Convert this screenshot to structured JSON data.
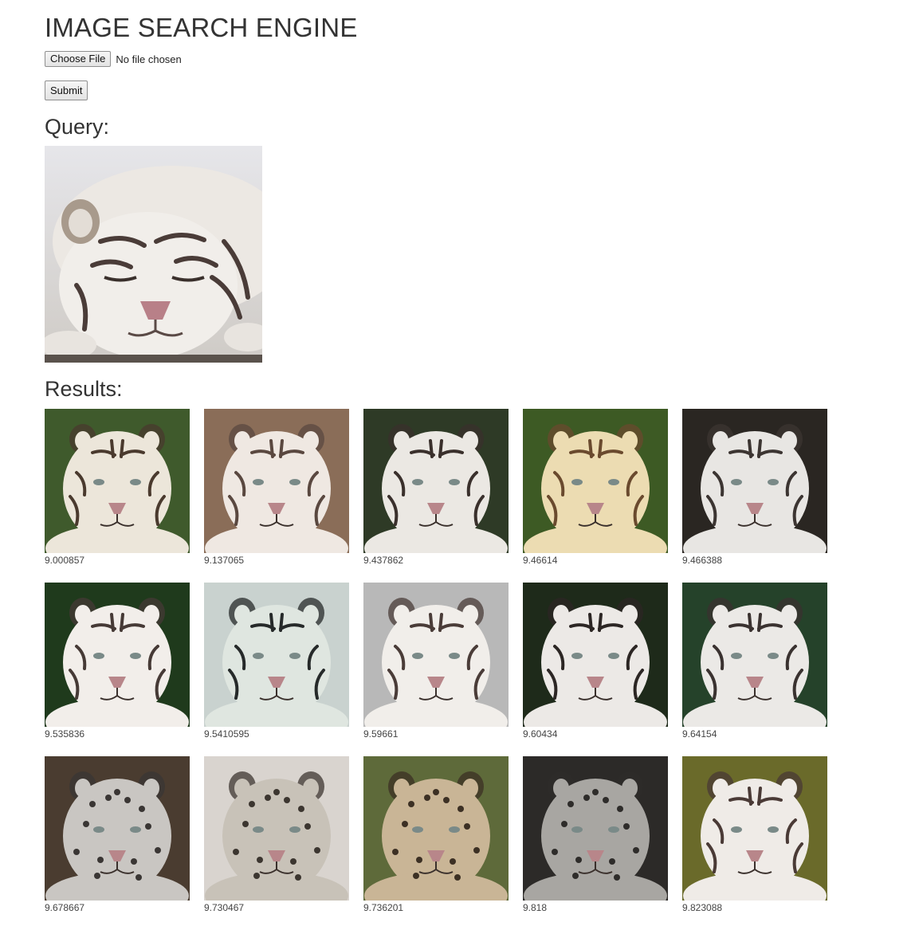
{
  "header": {
    "title": "IMAGE SEARCH ENGINE"
  },
  "form": {
    "choose_file_label": "Choose File",
    "file_status": "No file chosen",
    "submit_label": "Submit"
  },
  "query": {
    "heading": "Query:"
  },
  "results": {
    "heading": "Results:",
    "items": [
      {
        "score": "9.000857",
        "bg": "#3f5a2c",
        "fur": "#ece6da",
        "stripe": "#4a3a2e"
      },
      {
        "score": "9.137065",
        "bg": "#8a6d58",
        "fur": "#efe8e2",
        "stripe": "#5a4840"
      },
      {
        "score": "9.437862",
        "bg": "#2e3a26",
        "fur": "#ebe8e3",
        "stripe": "#3a302c"
      },
      {
        "score": "9.46614",
        "bg": "#3d5a24",
        "fur": "#ecdcb2",
        "stripe": "#6a4a2e"
      },
      {
        "score": "9.466388",
        "bg": "#2a2622",
        "fur": "#e8e6e3",
        "stripe": "#3c3532"
      },
      {
        "score": "9.535836",
        "bg": "#1f3a1c",
        "fur": "#f2eeea",
        "stripe": "#463a36"
      },
      {
        "score": "9.5410595",
        "bg": "#c9d2cf",
        "fur": "#dfe6e0",
        "stripe": "#262a2a"
      },
      {
        "score": "9.59661",
        "bg": "#b8b8b8",
        "fur": "#f1eeea",
        "stripe": "#4a3c38"
      },
      {
        "score": "9.60434",
        "bg": "#1e2a1a",
        "fur": "#ece9e6",
        "stripe": "#2c2624"
      },
      {
        "score": "9.64154",
        "bg": "#25422a",
        "fur": "#ebe9e6",
        "stripe": "#3a3230"
      },
      {
        "score": "9.678667",
        "bg": "#4a3c30",
        "fur": "#c9c6c2",
        "stripe": "#3a3634",
        "spots": true
      },
      {
        "score": "9.730467",
        "bg": "#d9d4cf",
        "fur": "#c8c2b8",
        "stripe": "#3c3630",
        "spots": true
      },
      {
        "score": "9.736201",
        "bg": "#5e6a3a",
        "fur": "#c9b596",
        "stripe": "#3c3024",
        "spots": true
      },
      {
        "score": "9.818",
        "bg": "#2c2a28",
        "fur": "#a8a6a2",
        "stripe": "#2e2c2a",
        "spots": true
      },
      {
        "score": "9.823088",
        "bg": "#6a6a2a",
        "fur": "#efebe7",
        "stripe": "#4a3a36"
      }
    ]
  }
}
